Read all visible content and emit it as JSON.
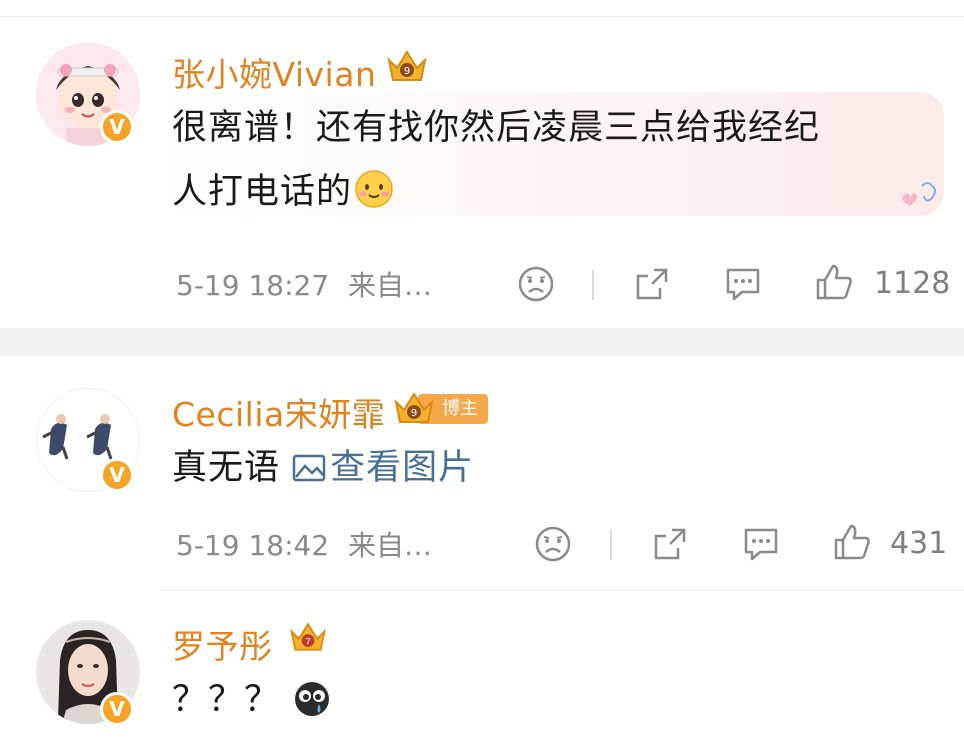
{
  "comments": [
    {
      "username": "张小婉Vivian",
      "text_line1": "很离谱！还有找你然后凌晨三点给我经纪",
      "text_line2": "人打电话的",
      "time": "5-19 18:27",
      "source": "来自…",
      "likes": "1128",
      "verified_badge": "V"
    },
    {
      "username": "Cecilia宋妍霏",
      "tag": "博主",
      "text": "真无语",
      "image_link": "查看图片",
      "time": "5-19 18:42",
      "source": "来自…",
      "likes": "431",
      "verified_badge": "V"
    },
    {
      "username": "罗予彤",
      "text": "？？？",
      "verified_badge": "V"
    }
  ],
  "icons": {
    "crown": "crown-icon",
    "dislike": "sad-face-icon",
    "share": "share-icon",
    "comment": "comment-bubble-icon",
    "like": "thumbs-up-icon",
    "emoji_smile": "smile-emoji",
    "emoji_cry": "crying-emoji",
    "image": "image-icon"
  },
  "colors": {
    "username": "#e0821e",
    "badge": "#f7a326",
    "link": "#4a6f95",
    "meta": "#8a8a8a"
  }
}
